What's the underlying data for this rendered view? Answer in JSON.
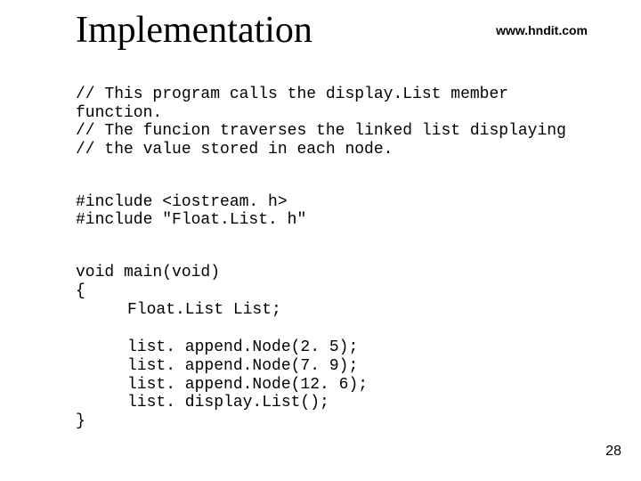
{
  "header": {
    "title": "Implementation",
    "url": "www.hndit.com"
  },
  "block1": {
    "l1": "// This program calls the display.List member",
    "l2": "function.",
    "l3": "// The funcion traverses the linked list displaying",
    "l4": "// the value stored in each node."
  },
  "block2": {
    "l1": "#include <iostream. h>",
    "l2": "#include \"Float.List. h\""
  },
  "block3": {
    "l1": "void main(void)",
    "l2": "{",
    "l3": "Float.List List;"
  },
  "block4": {
    "l1": "list. append.Node(2. 5);",
    "l2": "list. append.Node(7. 9);",
    "l3": "list. append.Node(12. 6);",
    "l4": "list. display.List();",
    "close": "}"
  },
  "page_number": "28"
}
